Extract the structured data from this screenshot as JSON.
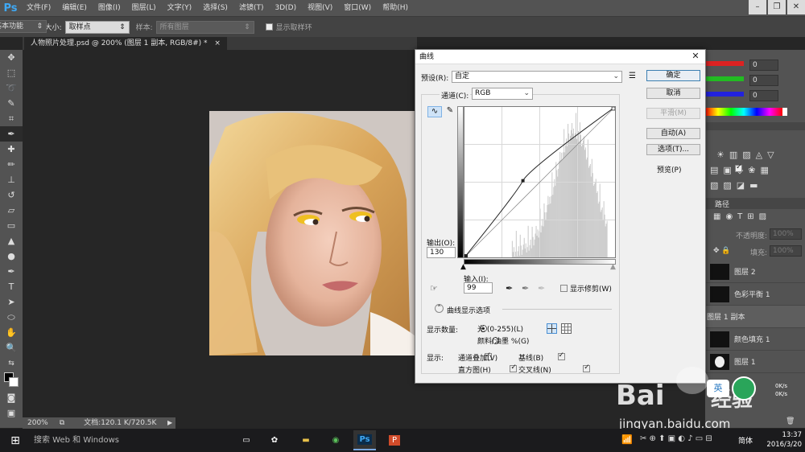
{
  "app": {
    "logo": "Ps"
  },
  "menu": [
    "文件(F)",
    "编辑(E)",
    "图像(I)",
    "图层(L)",
    "文字(Y)",
    "选择(S)",
    "滤镜(T)",
    "3D(D)",
    "视图(V)",
    "窗口(W)",
    "帮助(H)"
  ],
  "options": {
    "sample_size_label": "取样大小:",
    "sample_size_value": "取样点",
    "sample_label": "样本:",
    "sample_value": "所有图层",
    "show_ring_label": "显示取样环",
    "workspace": "基本功能"
  },
  "document": {
    "tab": "人物照片处理.psd @ 200% (图层 1 副本, RGB/8#) *",
    "zoom": "200%",
    "doc_size": "文档:120.1 K/720.5K"
  },
  "right_panel": {
    "inputs": [
      "0",
      "0",
      "0"
    ],
    "paths_tab": "路径",
    "opacity_label": "不透明度:",
    "opacity_value": "100%",
    "fill_label": "填充:",
    "fill_value": "100%",
    "layers": [
      "图层 2",
      "色彩平衡 1",
      "图层 1 副本",
      "颜色填充 1",
      "图层 1"
    ]
  },
  "dialog": {
    "title": "曲线",
    "preset_label": "预设(R):",
    "preset_value": "自定",
    "channel_label": "通道(C):",
    "channel_value": "RGB",
    "output_label": "输出(O):",
    "output_value": "130",
    "input_label": "输入(I):",
    "input_value": "99",
    "show_clipping": "显示修剪(W)",
    "display_options": "曲线显示选项",
    "display_amount_label": "显示数量:",
    "radio_light": "光 (0-255)(L)",
    "radio_pigment": "颜料/油墨 %(G)",
    "show_label": "显示:",
    "check_channel_overlays": "通道叠加(V)",
    "check_baseline": "基线(B)",
    "check_histogram": "直方图(H)",
    "check_intersection": "交叉线(N)",
    "buttons": {
      "ok": "确定",
      "cancel": "取消",
      "smooth": "平滑(M)",
      "auto": "自动(A)",
      "options": "选项(T)...",
      "preview": "预览(P)"
    }
  },
  "curve": {
    "point_input": 99,
    "point_output": 130
  },
  "taskbar": {
    "search": "搜索 Web 和 Windows",
    "ime": "简体",
    "time": "13:37",
    "date": "2016/3/20"
  },
  "watermark": {
    "brand": "Bai",
    "cn": "经验",
    "url": "jingyan.baidu.com"
  },
  "net_speed": [
    "0K/s",
    "0K/s"
  ],
  "ime_label": "英"
}
